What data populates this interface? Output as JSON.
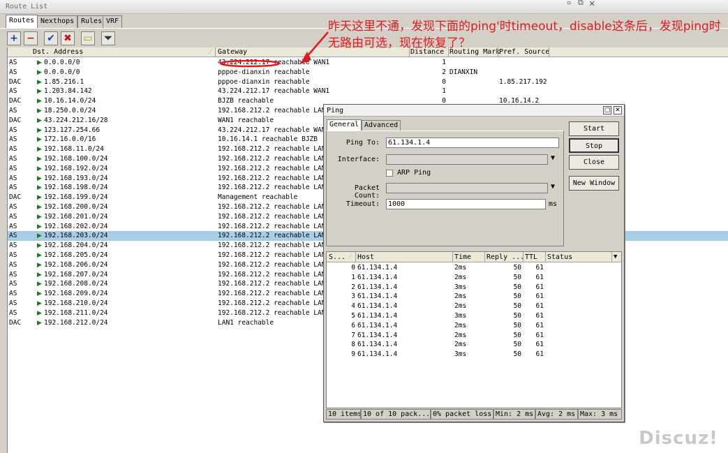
{
  "window": {
    "title": "Route List"
  },
  "tabs": [
    "Routes",
    "Nexthops",
    "Rules",
    "VRF"
  ],
  "toolbar": [
    {
      "icon": "add-icon",
      "glyph": "+",
      "color": "#1a3fb0"
    },
    {
      "icon": "remove-icon",
      "glyph": "−",
      "color": "#c01818"
    },
    {
      "icon": "enable-check-icon",
      "glyph": "✔",
      "color": "#1a3fb0"
    },
    {
      "icon": "disable-x-icon",
      "glyph": "✖",
      "color": "#c01818"
    },
    {
      "icon": "comment-icon",
      "glyph": "▭",
      "color": "#b89800"
    },
    {
      "icon": "filter-icon",
      "glyph": "⏷",
      "color": "#333333"
    }
  ],
  "grid": {
    "columns": [
      "Dst. Address",
      "Gateway",
      "Distance",
      "Routing Mark",
      "Pref. Source"
    ],
    "rows": [
      {
        "flags": "AS",
        "dst": "0.0.0.0/0",
        "gateway": "43.224.212.17 reachable WAN1",
        "distance": "1",
        "mark": "",
        "pref": ""
      },
      {
        "flags": "AS",
        "dst": "0.0.0.0/0",
        "gateway": "pppoe-dianxin reachable",
        "distance": "2",
        "mark": "DIANXIN",
        "pref": ""
      },
      {
        "flags": "DAC",
        "dst": "1.85.216.1",
        "gateway": "pppoe-dianxin reachable",
        "distance": "0",
        "mark": "",
        "pref": "1.85.217.192"
      },
      {
        "flags": "AS",
        "dst": "1.203.84.142",
        "gateway": "43.224.212.17 reachable WAN1",
        "distance": "1",
        "mark": "",
        "pref": ""
      },
      {
        "flags": "DAC",
        "dst": "10.16.14.0/24",
        "gateway": "BJZB reachable",
        "distance": "0",
        "mark": "",
        "pref": "10.16.14.2"
      },
      {
        "flags": "AS",
        "dst": "18.250.0.0/24",
        "gateway": "192.168.212.2 reachable LAN1",
        "distance": "",
        "mark": "",
        "pref": ""
      },
      {
        "flags": "DAC",
        "dst": "43.224.212.16/28",
        "gateway": "WAN1 reachable",
        "distance": "",
        "mark": "",
        "pref": ""
      },
      {
        "flags": "AS",
        "dst": "123.127.254.66",
        "gateway": "43.224.212.17 reachable WAN1",
        "distance": "",
        "mark": "",
        "pref": ""
      },
      {
        "flags": "AS",
        "dst": "172.16.0.0/16",
        "gateway": "10.16.14.1 reachable BJZB",
        "distance": "",
        "mark": "",
        "pref": ""
      },
      {
        "flags": "AS",
        "dst": "192.168.11.0/24",
        "gateway": "192.168.212.2 reachable LAN1",
        "distance": "",
        "mark": "",
        "pref": ""
      },
      {
        "flags": "AS",
        "dst": "192.168.100.0/24",
        "gateway": "192.168.212.2 reachable LAN1",
        "distance": "",
        "mark": "",
        "pref": ""
      },
      {
        "flags": "AS",
        "dst": "192.168.192.0/24",
        "gateway": "192.168.212.2 reachable LAN1",
        "distance": "",
        "mark": "",
        "pref": ""
      },
      {
        "flags": "AS",
        "dst": "192.168.193.0/24",
        "gateway": "192.168.212.2 reachable LAN1",
        "distance": "",
        "mark": "",
        "pref": ""
      },
      {
        "flags": "AS",
        "dst": "192.168.198.0/24",
        "gateway": "192.168.212.2 reachable LAN1",
        "distance": "",
        "mark": "",
        "pref": ""
      },
      {
        "flags": "DAC",
        "dst": "192.168.199.0/24",
        "gateway": "Management reachable",
        "distance": "",
        "mark": "",
        "pref": ""
      },
      {
        "flags": "AS",
        "dst": "192.168.200.0/24",
        "gateway": "192.168.212.2 reachable LAN1",
        "distance": "",
        "mark": "",
        "pref": ""
      },
      {
        "flags": "AS",
        "dst": "192.168.201.0/24",
        "gateway": "192.168.212.2 reachable LAN1",
        "distance": "",
        "mark": "",
        "pref": ""
      },
      {
        "flags": "AS",
        "dst": "192.168.202.0/24",
        "gateway": "192.168.212.2 reachable LAN1",
        "distance": "",
        "mark": "",
        "pref": ""
      },
      {
        "flags": "AS",
        "dst": "192.168.203.0/24",
        "gateway": "192.168.212.2 reachable LAN1",
        "distance": "",
        "mark": "",
        "pref": "",
        "selected": true
      },
      {
        "flags": "AS",
        "dst": "192.168.204.0/24",
        "gateway": "192.168.212.2 reachable LAN1",
        "distance": "",
        "mark": "",
        "pref": ""
      },
      {
        "flags": "AS",
        "dst": "192.168.205.0/24",
        "gateway": "192.168.212.2 reachable LAN1",
        "distance": "",
        "mark": "",
        "pref": ""
      },
      {
        "flags": "AS",
        "dst": "192.168.206.0/24",
        "gateway": "192.168.212.2 reachable LAN1",
        "distance": "",
        "mark": "",
        "pref": ""
      },
      {
        "flags": "AS",
        "dst": "192.168.207.0/24",
        "gateway": "192.168.212.2 reachable LAN1",
        "distance": "",
        "mark": "",
        "pref": ""
      },
      {
        "flags": "AS",
        "dst": "192.168.208.0/24",
        "gateway": "192.168.212.2 reachable LAN1",
        "distance": "",
        "mark": "",
        "pref": ""
      },
      {
        "flags": "AS",
        "dst": "192.168.209.0/24",
        "gateway": "192.168.212.2 reachable LAN1",
        "distance": "",
        "mark": "",
        "pref": ""
      },
      {
        "flags": "AS",
        "dst": "192.168.210.0/24",
        "gateway": "192.168.212.2 reachable LAN1",
        "distance": "",
        "mark": "",
        "pref": ""
      },
      {
        "flags": "AS",
        "dst": "192.168.211.0/24",
        "gateway": "192.168.212.2 reachable LAN1",
        "distance": "",
        "mark": "",
        "pref": ""
      },
      {
        "flags": "DAC",
        "dst": "192.168.212.0/24",
        "gateway": "LAN1 reachable",
        "distance": "",
        "mark": "",
        "pref": ""
      }
    ]
  },
  "annotation": {
    "text": "昨天这里不通，发现下面的ping'时timeout，disable这条后，发现ping时无路由可选，现在恢复了？",
    "color": "#e0191b"
  },
  "ping": {
    "title": "Ping",
    "tabs": [
      "General",
      "Advanced"
    ],
    "ping_to_label": "Ping To:",
    "ping_to_value": "61.134.1.4",
    "interface_label": "Interface:",
    "arp_ping_label": "ARP Ping",
    "packet_count_label": "Packet Count:",
    "timeout_label": "Timeout:",
    "timeout_value": "1000",
    "timeout_unit": "ms",
    "buttons": [
      "Start",
      "Stop",
      "Close",
      "New Window"
    ],
    "columns": [
      "S...",
      "Host",
      "Time",
      "Reply ...",
      "TTL",
      "Status"
    ],
    "results": [
      {
        "seq": "0",
        "host": "61.134.1.4",
        "time": "2ms",
        "reply": "50",
        "ttl": "61"
      },
      {
        "seq": "1",
        "host": "61.134.1.4",
        "time": "2ms",
        "reply": "50",
        "ttl": "61"
      },
      {
        "seq": "2",
        "host": "61.134.1.4",
        "time": "3ms",
        "reply": "50",
        "ttl": "61"
      },
      {
        "seq": "3",
        "host": "61.134.1.4",
        "time": "2ms",
        "reply": "50",
        "ttl": "61"
      },
      {
        "seq": "4",
        "host": "61.134.1.4",
        "time": "2ms",
        "reply": "50",
        "ttl": "61"
      },
      {
        "seq": "5",
        "host": "61.134.1.4",
        "time": "3ms",
        "reply": "50",
        "ttl": "61"
      },
      {
        "seq": "6",
        "host": "61.134.1.4",
        "time": "2ms",
        "reply": "50",
        "ttl": "61"
      },
      {
        "seq": "7",
        "host": "61.134.1.4",
        "time": "2ms",
        "reply": "50",
        "ttl": "61"
      },
      {
        "seq": "8",
        "host": "61.134.1.4",
        "time": "2ms",
        "reply": "50",
        "ttl": "61"
      },
      {
        "seq": "9",
        "host": "61.134.1.4",
        "time": "3ms",
        "reply": "50",
        "ttl": "61"
      }
    ],
    "status": [
      "10 items",
      "10 of 10 pack...",
      "0% packet loss",
      "Min: 2 ms",
      "Avg: 2 ms",
      "Max: 3 ms"
    ]
  },
  "watermark": "Discuz!"
}
